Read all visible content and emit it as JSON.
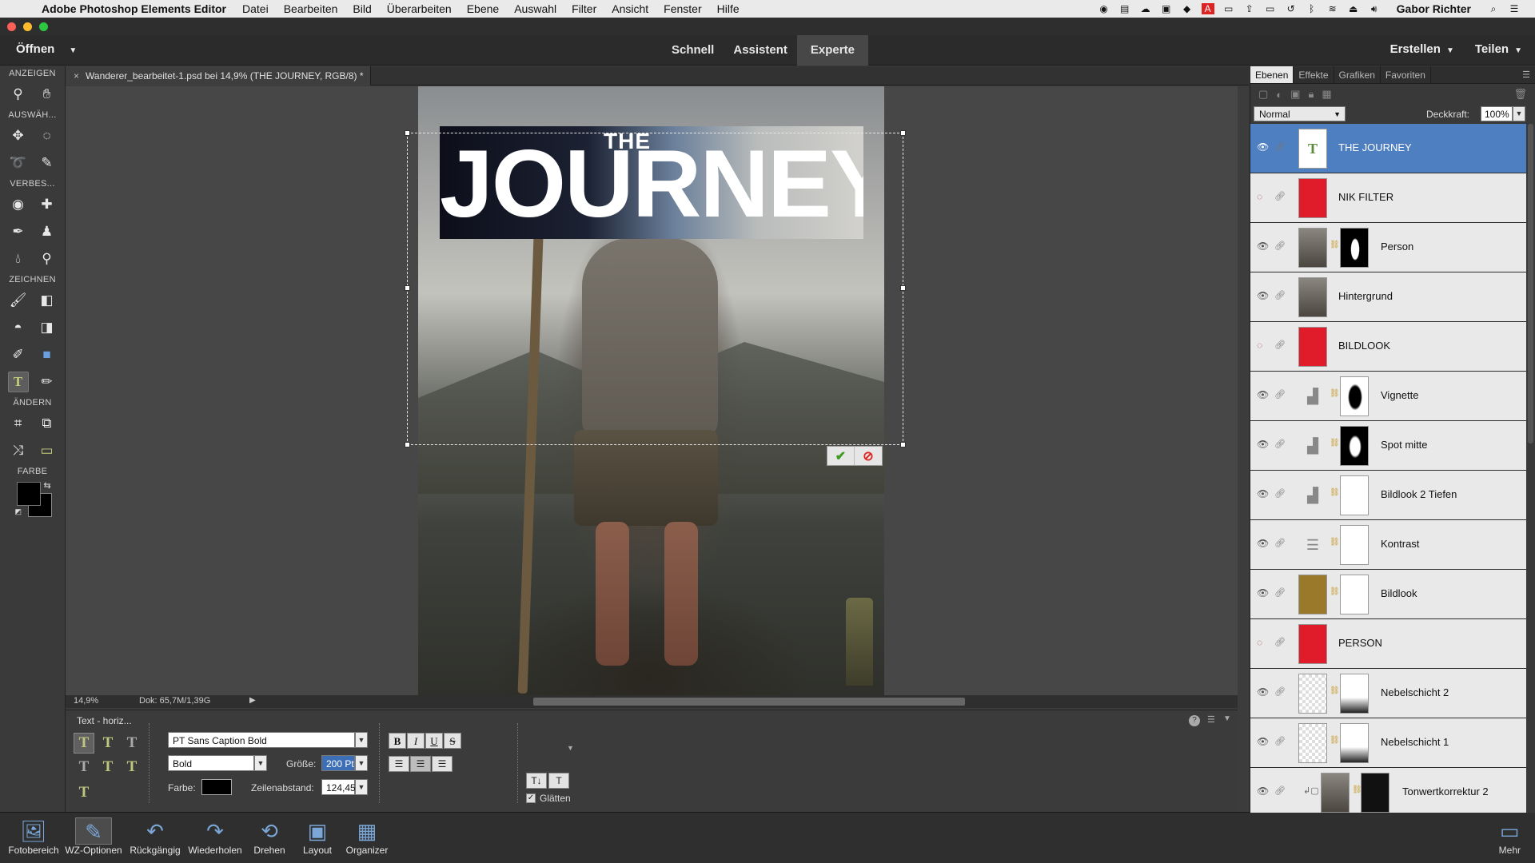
{
  "menubar": {
    "app_name": "Adobe Photoshop Elements Editor",
    "items": [
      "Datei",
      "Bearbeiten",
      "Bild",
      "Überarbeiten",
      "Ebene",
      "Auswahl",
      "Filter",
      "Ansicht",
      "Fenster",
      "Hilfe"
    ],
    "user": "Gabor Richter"
  },
  "modebar": {
    "open_label": "Öffnen",
    "modes": [
      "Schnell",
      "Assistent",
      "Experte"
    ],
    "active_mode": "Experte",
    "create_label": "Erstellen",
    "share_label": "Teilen"
  },
  "toolbox": {
    "sections": [
      "ANZEIGEN",
      "AUSWÄH...",
      "VERBES...",
      "ZEICHNEN",
      "ÄNDERN",
      "FARBE"
    ]
  },
  "document": {
    "tab_label": "Wanderer_bearbeitet-1.psd bei 14,9% (THE JOURNEY, RGB/8) *",
    "close_glyph": "×"
  },
  "canvas_text": {
    "small": "THE",
    "large": "JOURNEY"
  },
  "statusbar": {
    "zoom": "14,9%",
    "doc_size": "Dok: 65,7M/1,39G"
  },
  "tool_options": {
    "title": "Text - horiz...",
    "font_family": "PT Sans Caption Bold",
    "font_style": "Bold",
    "size_label": "Größe:",
    "size_value": "200 Pt",
    "color_label": "Farbe:",
    "leading_label": "Zeilenabstand:",
    "leading_value": "124,45",
    "antialias_label": "Glätten",
    "antialias_checked": true
  },
  "taskbar": {
    "items": [
      "Fotobereich",
      "WZ-Optionen",
      "Rückgängig",
      "Wiederholen",
      "Drehen",
      "Layout",
      "Organizer"
    ],
    "more": "Mehr"
  },
  "panel": {
    "tabs": [
      "Ebenen",
      "Effekte",
      "Grafiken",
      "Favoriten"
    ],
    "active_tab": "Ebenen",
    "blend_mode": "Normal",
    "opacity_label": "Deckkraft:",
    "opacity_value": "100%",
    "layers": [
      {
        "name": "THE JOURNEY",
        "visible": true,
        "selected": true
      },
      {
        "name": "NIK FILTER",
        "visible": false
      },
      {
        "name": "Person",
        "visible": true
      },
      {
        "name": "Hintergrund",
        "visible": true
      },
      {
        "name": "BILDLOOK",
        "visible": false
      },
      {
        "name": "Vignette",
        "visible": true
      },
      {
        "name": "Spot mitte",
        "visible": true
      },
      {
        "name": "Bildlook 2 Tiefen",
        "visible": true
      },
      {
        "name": "Kontrast",
        "visible": true
      },
      {
        "name": "Bildlook",
        "visible": true
      },
      {
        "name": "PERSON",
        "visible": false
      },
      {
        "name": "Nebelschicht 2",
        "visible": true
      },
      {
        "name": "Nebelschicht 1",
        "visible": true
      },
      {
        "name": "Tonwertkorrektur 2",
        "visible": true
      }
    ]
  },
  "colors": {
    "selection": "#4d7fc1",
    "layer_red": "#e01c2b",
    "commit_green": "#3c9b1e",
    "cancel_red": "#dd2222"
  }
}
